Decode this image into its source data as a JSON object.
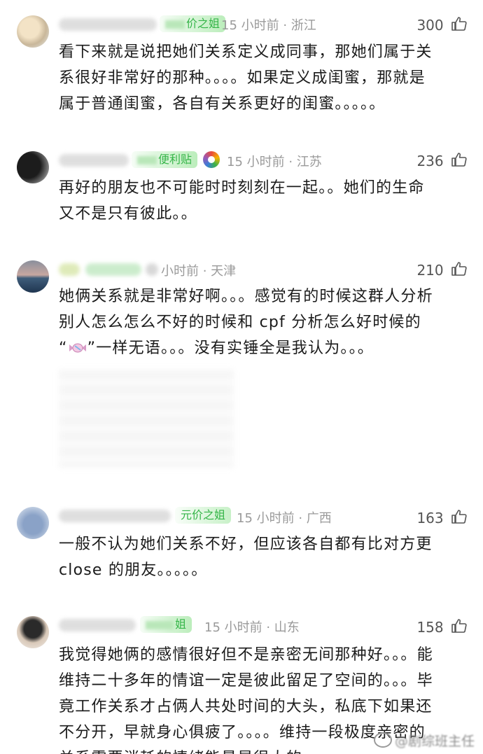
{
  "comments": [
    {
      "badge_text": "价之姐",
      "meta": "15 小时前 · 浙江",
      "likes": "300",
      "lines": [
        "看下来就是说把她们关系定义成同事，那她们属于关",
        "系很好非常好的那种。。。。如果定义成闺蜜，那就是",
        "属于普通闺蜜，各自有关系更好的闺蜜。。。。。"
      ]
    },
    {
      "badge_text": "便利贴",
      "meta": "15 小时前 · 江苏",
      "likes": "236",
      "lines": [
        "再好的朋友也不可能时时刻刻在一起。。她们的生命",
        "又不是只有彼此。。"
      ]
    },
    {
      "badge_text": "",
      "meta": "小时前 · 天津",
      "likes": "210",
      "lines": [
        "她俩关系就是非常好啊。。。感觉有的时候这群人分析",
        "别人怎么怎么不好的时候和 cpf 分析怎么好时候的"
      ],
      "line3_prefix": "“",
      "line3_suffix": "”一样无语。。。没有实锤全是我认为。。。"
    },
    {
      "badge_text": "元价之姐",
      "meta": "15 小时前 · 广西",
      "likes": "163",
      "lines": [
        "一般不认为她们关系不好，但应该各自都有比对方更",
        "close 的朋友。。。。。"
      ]
    },
    {
      "badge_text": "姐",
      "meta": "15 小时前 · 山东",
      "likes": "158",
      "lines": [
        "我觉得她俩的感情很好但不是亲密无间那种好。。。能",
        "维持二十多年的情谊一定是彼此留足了空间的。。。毕",
        "竟工作关系才占俩人共处时间的大头，私底下如果还",
        "不分开，早就身心俱疲了。。。。维持一段极度亲密的",
        "关系需要消耗的情绪能量是很大的"
      ]
    }
  ],
  "watermark": "@剧综班主任",
  "icons": {
    "like": "thumbs-up-icon",
    "candy": "candy-emoji-icon",
    "weibo": "weibo-logo-icon"
  },
  "colors": {
    "badge_green": "#35b548",
    "meta_gray": "#9a9a9a",
    "text": "#1b1b1b"
  }
}
